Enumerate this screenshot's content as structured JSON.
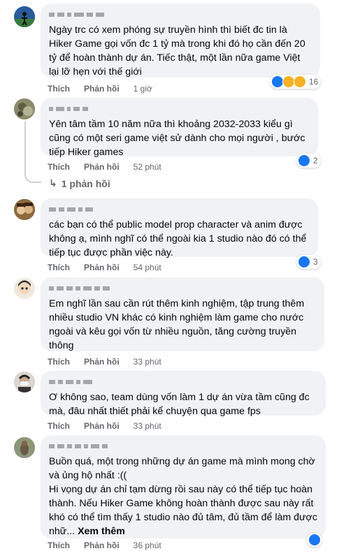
{
  "colors": {
    "bubble": "#f0f2f5",
    "secondary_text": "#65676b",
    "like_blue": "#1877f2",
    "love_red": "#f33e58",
    "haha_yellow": "#f7b125"
  },
  "labels": {
    "like": "Thích",
    "reply": "Phản hồi"
  },
  "comments": [
    {
      "text": "Ngày trc có xem phóng sự truyền hình thì biết đc tin là Hiker Game gọi vốn đc 1 tỷ mà trong khi đó họ cần đến 20 tỷ để hoàn thành dự án. Tiếc thật, một lần nữa game Việt lại lỡ hẹn với thế giới",
      "time": "1 giờ",
      "reactions": [
        "like",
        "sad",
        "haha"
      ],
      "reaction_count": "16"
    },
    {
      "text": "Yên tâm tầm 10 năm nữa thì khoảng 2032-2033 kiểu gì cũng có một seri game việt sử dành cho mọi người , bước tiếp Hiker games",
      "time": "52 phút",
      "reactions": [
        "like"
      ],
      "reaction_count": "2",
      "replies_label": "1 phản hồi"
    },
    {
      "text": "các bạn có thể public model prop character và anim được không ạ, mình nghĩ có thể ngoài kia 1 studio nào đó có thể tiếp tục được phần việc này.",
      "time": "54 phút",
      "reactions": [
        "like"
      ],
      "reaction_count": "3"
    },
    {
      "text": "Em nghĩ lần sau cần rút thêm kinh nghiệm, tập trung thêm nhiều studio VN khác có kinh nghiệm làm game cho nước ngoài và kêu gọi vốn từ nhiều nguồn, tăng cường truyền thông",
      "time": "33 phút",
      "reactions": [],
      "reaction_count": ""
    },
    {
      "text": "Ơ không sao, team dùng vốn làm 1 dự án vừa tầm cũng đc mà, đâu nhất thiết phải kể chuyện qua game fps",
      "time": "33 phút",
      "reactions": [],
      "reaction_count": ""
    },
    {
      "text": "Buồn quá, một trong những dự án game mà mình mong chờ và ủng hộ nhất :((\nHi vọng dự án chỉ tạm dừng rồi sau này có thể tiếp tục hoàn thành. Nếu Hiker Game không hoàn thành được sau này rất khó có thể tìm thấy 1 studio nào đủ tâm, đủ tầm để làm được nhữ...",
      "see_more": "Xem thêm",
      "time": "36 phút",
      "reactions": [
        "like"
      ],
      "reaction_count": ""
    }
  ]
}
